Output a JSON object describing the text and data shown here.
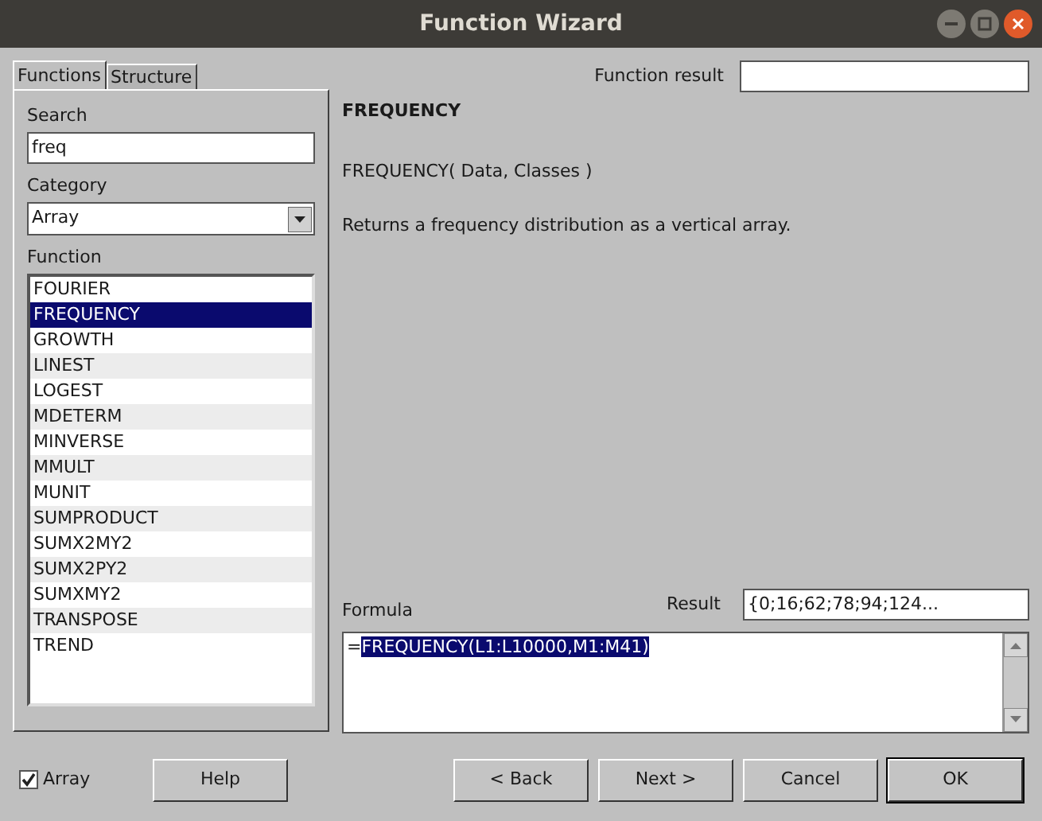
{
  "window": {
    "title": "Function Wizard"
  },
  "tabs": [
    {
      "label": "Functions",
      "selected": true
    },
    {
      "label": "Structure",
      "selected": false
    }
  ],
  "search": {
    "label": "Search",
    "value": "freq"
  },
  "category": {
    "label": "Category",
    "value": "Array"
  },
  "function_list": {
    "label": "Function",
    "items": [
      {
        "label": "FOURIER",
        "selected": false
      },
      {
        "label": "FREQUENCY",
        "selected": true
      },
      {
        "label": "GROWTH",
        "selected": false
      },
      {
        "label": "LINEST",
        "selected": false
      },
      {
        "label": "LOGEST",
        "selected": false
      },
      {
        "label": "MDETERM",
        "selected": false
      },
      {
        "label": "MINVERSE",
        "selected": false
      },
      {
        "label": "MMULT",
        "selected": false
      },
      {
        "label": "MUNIT",
        "selected": false
      },
      {
        "label": "SUMPRODUCT",
        "selected": false
      },
      {
        "label": "SUMX2MY2",
        "selected": false
      },
      {
        "label": "SUMX2PY2",
        "selected": false
      },
      {
        "label": "SUMXMY2",
        "selected": false
      },
      {
        "label": "TRANSPOSE",
        "selected": false
      },
      {
        "label": "TREND",
        "selected": false
      }
    ]
  },
  "function_result": {
    "label": "Function result"
  },
  "function_name": "FREQUENCY",
  "syntax": "FREQUENCY( Data, Classes )",
  "description": "Returns a frequency distribution as a vertical array.",
  "formula": {
    "label": "Formula",
    "prefix": "=",
    "selection": "FREQUENCY(L1:L10000,M1:M41)"
  },
  "result": {
    "label": "Result",
    "value": "{0;16;62;78;94;124..."
  },
  "array_checkbox": {
    "label": "Array",
    "checked": true
  },
  "buttons": [
    {
      "label": "Help",
      "default": false
    },
    {
      "label": "< Back",
      "default": false
    },
    {
      "label": "Next >",
      "default": false
    },
    {
      "label": "Cancel",
      "default": false
    },
    {
      "label": "OK",
      "default": true
    }
  ]
}
